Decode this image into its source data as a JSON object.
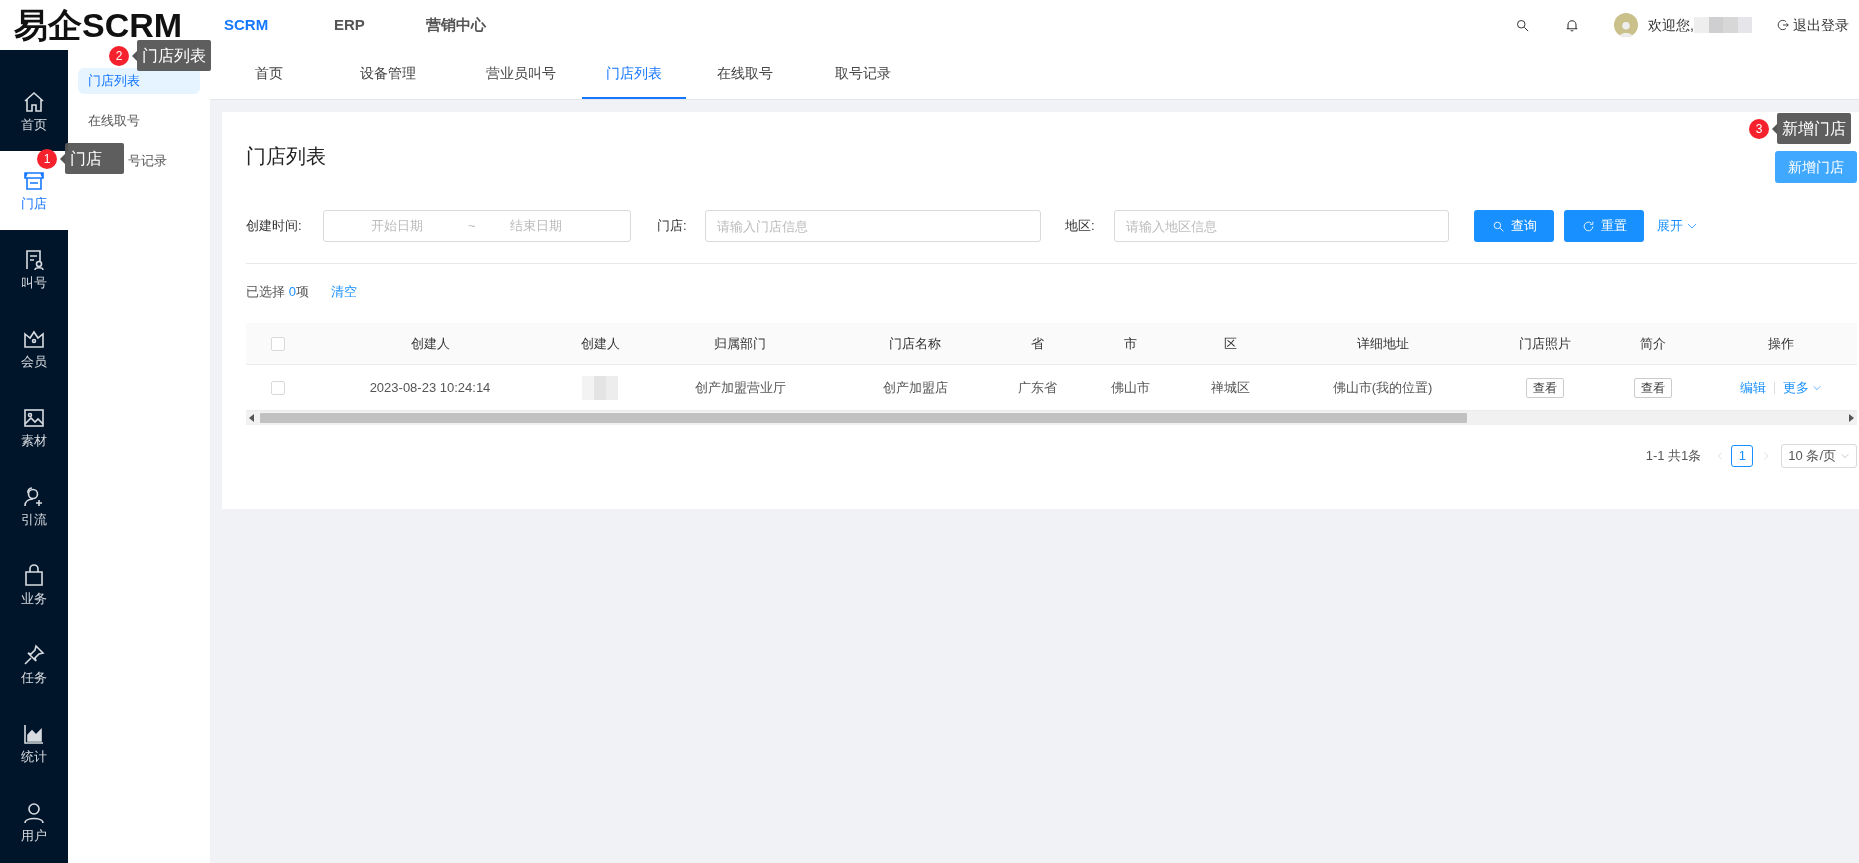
{
  "app": {
    "logo": "易企SCRM"
  },
  "top_nav": [
    {
      "label": "SCRM",
      "selected": true
    },
    {
      "label": "ERP",
      "selected": false
    },
    {
      "label": "营销中心",
      "selected": false
    }
  ],
  "user": {
    "greeting": "欢迎您,",
    "logout": "退出登录"
  },
  "rail": [
    {
      "label": "首页",
      "selected": false
    },
    {
      "label": "门店",
      "selected": true
    },
    {
      "label": "叫号",
      "selected": false
    },
    {
      "label": "会员",
      "selected": false
    },
    {
      "label": "素材",
      "selected": false
    },
    {
      "label": "引流",
      "selected": false
    },
    {
      "label": "业务",
      "selected": false
    },
    {
      "label": "任务",
      "selected": false
    },
    {
      "label": "统计",
      "selected": false
    },
    {
      "label": "用户",
      "selected": false
    }
  ],
  "submenu": [
    {
      "label": "门店列表",
      "selected": true
    },
    {
      "label": "在线取号",
      "selected": false
    },
    {
      "label": "号记录",
      "selected": false
    }
  ],
  "tabs": [
    {
      "label": "首页",
      "selected": false
    },
    {
      "label": "设备管理",
      "selected": false
    },
    {
      "label": "营业员叫号",
      "selected": false
    },
    {
      "label": "门店列表",
      "selected": true
    },
    {
      "label": "在线取号",
      "selected": false
    },
    {
      "label": "取号记录",
      "selected": false
    }
  ],
  "page": {
    "title": "门店列表",
    "add_button": "新增门店"
  },
  "filters": {
    "created_label": "创建时间:",
    "start_placeholder": "开始日期",
    "separator": "~",
    "end_placeholder": "结束日期",
    "store_label": "门店:",
    "store_placeholder": "请输入门店信息",
    "region_label": "地区:",
    "region_placeholder": "请输入地区信息",
    "search_button": "查询",
    "reset_button": "重置",
    "expand": "展开"
  },
  "selection": {
    "prefix": "已选择 ",
    "count": "0",
    "suffix": "项",
    "clear": "清空"
  },
  "table": {
    "header_checked": false,
    "columns": [
      "创建人",
      "创建人",
      "归属部门",
      "门店名称",
      "省",
      "市",
      "区",
      "详细地址",
      "门店照片",
      "简介",
      "操作"
    ],
    "rows": [
      {
        "checked": false,
        "created_at": "2023-08-23 10:24:14",
        "department": "创产加盟营业厅",
        "store": "创产加盟店",
        "province": "广东省",
        "city": "佛山市",
        "district": "禅城区",
        "address": "佛山市(我的位置)",
        "photo_button": "查看",
        "intro_button": "查看",
        "actions": [
          "编辑",
          "更多"
        ]
      }
    ]
  },
  "pagination": {
    "summary": "1-1 共1条",
    "pages": [
      {
        "label": "1",
        "selected": true
      }
    ],
    "page_size": "10 条/页"
  },
  "annotations": [
    {
      "number": "1",
      "label": "门店"
    },
    {
      "number": "2",
      "label": "门店列表"
    },
    {
      "number": "3",
      "label": "新增门店"
    }
  ]
}
